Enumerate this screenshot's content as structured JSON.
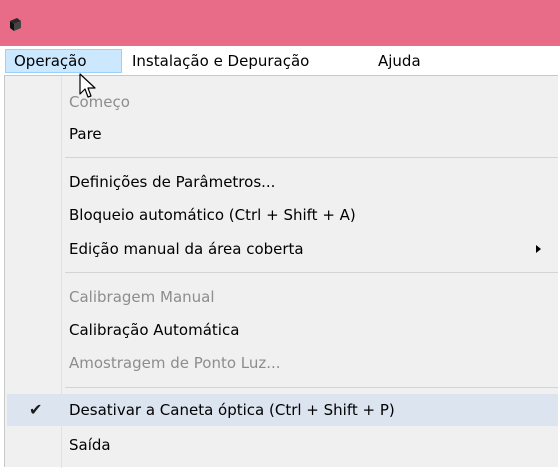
{
  "window": {
    "accent_color": "#e86c88",
    "icon": "app-icon"
  },
  "menubar": {
    "items": [
      {
        "label": "Operação",
        "active": true
      },
      {
        "label": "Instalação e Depuração",
        "active": false
      },
      {
        "label": "Ajuda",
        "active": false
      }
    ]
  },
  "menu": {
    "items": [
      {
        "label": "Começo",
        "enabled": false
      },
      {
        "label": "Pare",
        "enabled": true
      },
      {
        "label": "Definições de Parâmetros...",
        "enabled": true
      },
      {
        "label": "Bloqueio automático (Ctrl + Shift + A)",
        "enabled": true
      },
      {
        "label": "Edição manual da área coberta",
        "enabled": true,
        "submenu": true
      },
      {
        "label": "Calibragem Manual",
        "enabled": false
      },
      {
        "label": "Calibração Automática",
        "enabled": true
      },
      {
        "label": "Amostragem de Ponto Luz...",
        "enabled": false
      },
      {
        "label": "Desativar a Caneta óptica (Ctrl + Shift + P)",
        "enabled": true,
        "checked": true,
        "check_icon": "checkmark-icon"
      },
      {
        "label": "Saída",
        "enabled": true
      }
    ]
  }
}
